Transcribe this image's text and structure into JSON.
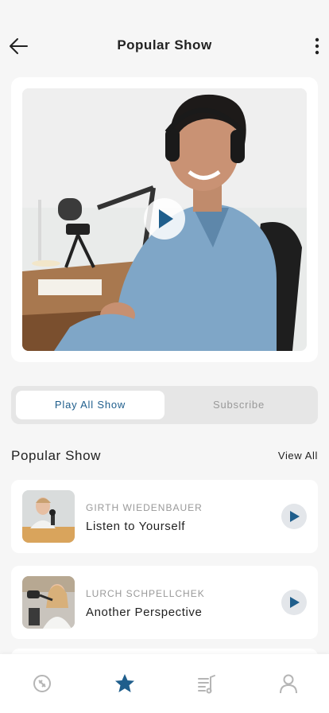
{
  "header": {
    "title": "Popular Show",
    "back_icon": "arrow-left-icon",
    "more_icon": "more-vertical-icon"
  },
  "hero": {
    "image": "podcast-host-with-headphones",
    "play_icon": "play-icon"
  },
  "segmented": {
    "active_label": "Play All Show",
    "inactive_label": "Subscribe"
  },
  "section": {
    "title": "Popular Show",
    "view_all_label": "View All"
  },
  "shows": [
    {
      "author": "GIRTH WIEDENBAUER",
      "title": "Listen to Yourself"
    },
    {
      "author": "LURCH SCHPELLCHEK",
      "title": "Another Perspective"
    }
  ],
  "tabbar": {
    "tabs": [
      {
        "icon": "compass-icon",
        "active": false
      },
      {
        "icon": "star-icon",
        "active": true
      },
      {
        "icon": "playlist-icon",
        "active": false
      },
      {
        "icon": "profile-icon",
        "active": false
      }
    ]
  },
  "colors": {
    "accent": "#1f5e8c",
    "background": "#f6f6f6",
    "muted": "#999999"
  }
}
